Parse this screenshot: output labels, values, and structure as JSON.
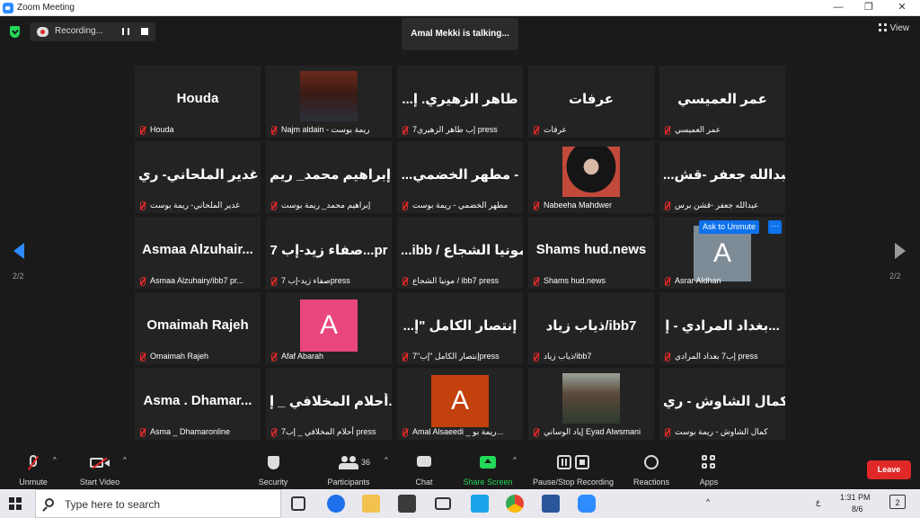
{
  "window": {
    "title": "Zoom Meeting",
    "min": "—",
    "max": "❐",
    "close": "✕"
  },
  "topbar": {
    "recording_label": "Recording...",
    "talking": "Amal Mekki is talking...",
    "view_label": "View"
  },
  "nav": {
    "left_page": "2/2",
    "right_page": "2/2"
  },
  "tiles": [
    {
      "big": "Houda",
      "name": "Houda"
    },
    {
      "big": "",
      "name": "Najm aldain - ريمة بوست"
    },
    {
      "big": "...طاهر الزهيري. إ",
      "name": "7إب طاهر الزهيري press"
    },
    {
      "big": "عرفات",
      "name": "عرفات"
    },
    {
      "big": "عمر العميسي",
      "name": "عمر العميسي"
    },
    {
      "big": "غدير الملحاني- ري",
      "name": "غدير الملحاني- ريمة بوست"
    },
    {
      "big": "إبراهيم محمد_ ريم",
      "name": "إبراهيم محمد_ ريمة بوست"
    },
    {
      "big": "...مطهر الخضمي -",
      "name": "مطهر الخضمي - ريمة بوست"
    },
    {
      "big": "",
      "name": "Nabeeha Mahdwer"
    },
    {
      "big": "...عبدالله جعفر -قش",
      "name": "عبدالله جعفر -قشن برس"
    },
    {
      "big": "Asmaa  Alzuhair...",
      "name": "Asmaa Alzuhairy/ibb7 pr..."
    },
    {
      "big": "صفاء زيد-إب 7...pr",
      "name": "صفاء زيد-إب 7press"
    },
    {
      "big": "...ibb / مونيا الشجاع",
      "name": "مونيا الشجاع / ibb7 press"
    },
    {
      "big": "Shams hud.news",
      "name": "Shams hud.news"
    },
    {
      "big": "",
      "name": "Asrar Aldhan"
    },
    {
      "big": "Omaimah Rajeh",
      "name": "Omaimah Rajeh"
    },
    {
      "big": "",
      "name": "Afaf Abarah"
    },
    {
      "big": "...إنتصار الكامل \"إ",
      "name": "إنتصار الكامل \"إب\"7press"
    },
    {
      "big": "ذياب زياد/ibb7",
      "name": "ذياب زياد/ibb7"
    },
    {
      "big": "بغداد المرادي - إ...",
      "name": "إب7 بغداد المرادي press"
    },
    {
      "big": "Asma . Dhamar...",
      "name": "Asma _ Dhamaronline"
    },
    {
      "big": "أحلام المخلافي _ إ...",
      "name": "أحلام المخلافي _ إب7 press"
    },
    {
      "big": "",
      "name": "Amal Alsaeedi _ ريمة بو..."
    },
    {
      "big": "",
      "name": "إياد الوساني Eyad Alwsmani"
    },
    {
      "big": "كمال الشاوش - ري...",
      "name": "كمال الشاوش - ريمة بوست"
    }
  ],
  "avatars": {
    "asrar": "A",
    "afaf": "A",
    "amal": "A"
  },
  "hover": {
    "ask_unmute": "Ask to Unmute",
    "more": "···"
  },
  "toolbar": {
    "unmute": "Unmute",
    "start_video": "Start Video",
    "security": "Security",
    "participants": "Participants",
    "participants_count": "36",
    "chat": "Chat",
    "share_screen": "Share Screen",
    "pause_stop": "Pause/Stop Recording",
    "reactions": "Reactions",
    "apps": "Apps",
    "leave": "Leave"
  },
  "taskbar": {
    "search_placeholder": "Type here to search",
    "time": "1:31 PM",
    "date": "8/6",
    "lang": "ع",
    "notif_count": "2"
  },
  "colors": {
    "avatar_asrar": "#7d8b96",
    "avatar_afaf": "#e8467c",
    "avatar_amal": "#c2410c",
    "leave": "#e02828",
    "share": "#23d959",
    "accent": "#0e72ed"
  },
  "icons": [
    "shield-icon",
    "record-icon",
    "pause-icon",
    "stop-icon",
    "grid-icon",
    "mic-muted-icon",
    "video-off-icon",
    "security-icon",
    "participants-icon",
    "chat-icon",
    "share-icon",
    "pause-record-icon",
    "reactions-icon",
    "apps-icon",
    "windows-start-icon",
    "search-icon"
  ]
}
